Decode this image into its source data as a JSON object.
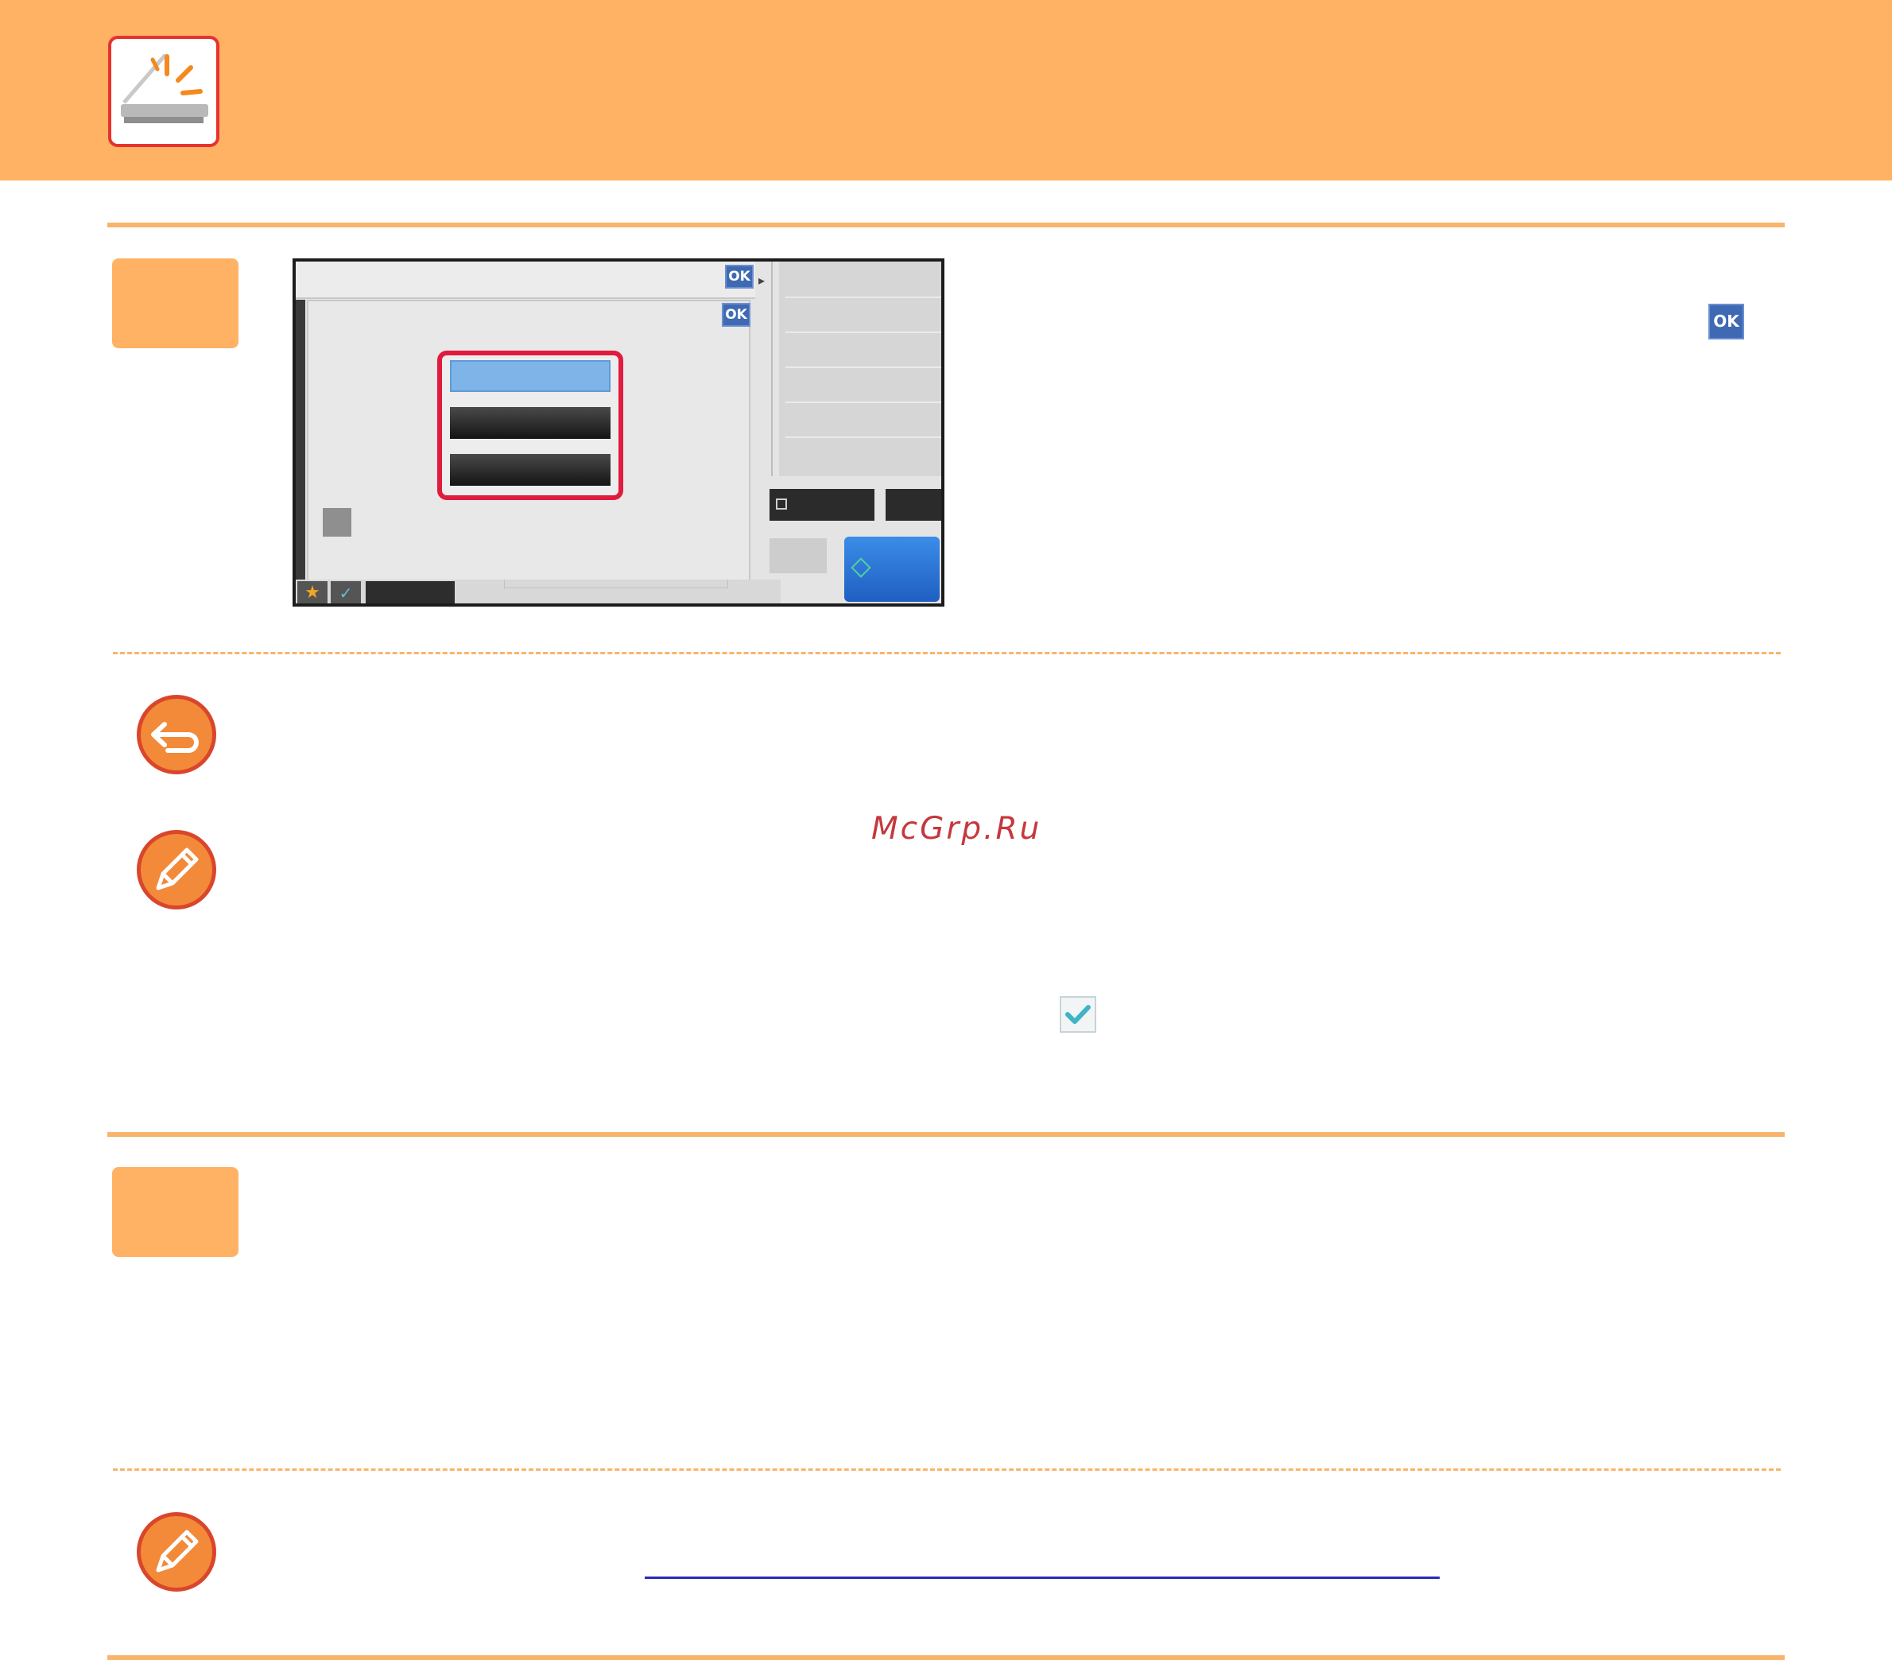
{
  "header": {
    "logo_icon": "scanner-icon",
    "band_color": "#ffb264"
  },
  "step1": {
    "number": "",
    "ok_inline_label": "OK",
    "screen": {
      "ok_top_label": "OK",
      "ok_dialog_label": "OK",
      "forward_glyph": "▸",
      "star_glyph": "★",
      "check_glyph": "✓"
    }
  },
  "notes": {
    "return_icon": "return-arrow-icon",
    "pencil_icon": "pencil-icon",
    "checkmark_icon": "checkmark-icon"
  },
  "watermark": "McGrp.Ru",
  "step2": {
    "number": ""
  },
  "colors": {
    "accent": "#ffb264",
    "rule": "#f9b46b",
    "highlight": "#e01b3d",
    "link": "#2a2ab8"
  }
}
